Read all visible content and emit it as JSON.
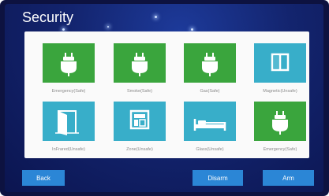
{
  "screen": {
    "title": "Security"
  },
  "zones": [
    {
      "label": "Emergency(Safe)",
      "icon": "plug-icon",
      "color": "#3aa53d"
    },
    {
      "label": "Smoke(Safe)",
      "icon": "plug-icon",
      "color": "#3aa53d"
    },
    {
      "label": "Gas(Safe)",
      "icon": "plug-icon",
      "color": "#3aa53d"
    },
    {
      "label": "Magnetic(Unsafe)",
      "icon": "window-icon",
      "color": "#38aec9"
    },
    {
      "label": "InFrared(Unsafe)",
      "icon": "door-icon",
      "color": "#38aec9"
    },
    {
      "label": "Zone(Unsafe)",
      "icon": "panel-icon",
      "color": "#38aec9"
    },
    {
      "label": "Glass(Unsafe)",
      "icon": "bed-icon",
      "color": "#38aec9"
    },
    {
      "label": "Emergency(Safe)",
      "icon": "plug-icon",
      "color": "#3aa53d"
    }
  ],
  "buttons": {
    "back": "Back",
    "disarm": "Disarm",
    "arm": "Arm"
  }
}
